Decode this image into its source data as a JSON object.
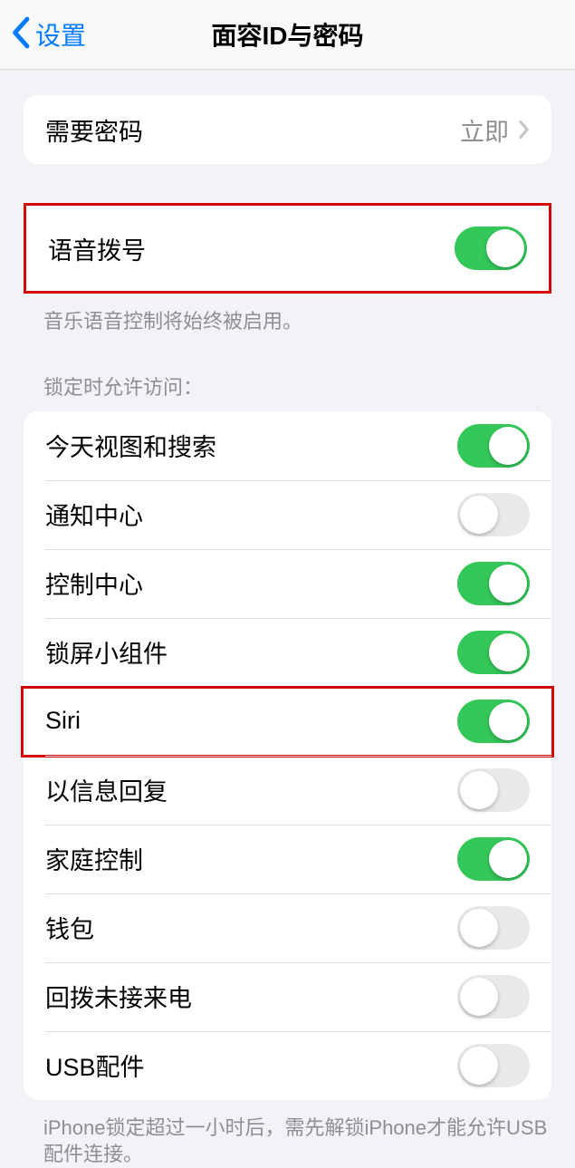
{
  "nav": {
    "back_label": "设置",
    "title": "面容ID与密码"
  },
  "passcode": {
    "label": "需要密码",
    "value": "立即"
  },
  "voice_dial": {
    "label": "语音拨号",
    "footer": "音乐语音控制将始终被启用。"
  },
  "locked_access": {
    "header": "锁定时允许访问：",
    "items": {
      "today": "今天视图和搜索",
      "notification": "通知中心",
      "control": "控制中心",
      "widgets": "锁屏小组件",
      "siri": "Siri",
      "reply": "以信息回复",
      "home": "家庭控制",
      "wallet": "钱包",
      "callback": "回拨未接来电",
      "usb": "USB配件"
    }
  },
  "usb_footer": "iPhone锁定超过一小时后，需先解锁iPhone才能允许USB配件连接。"
}
